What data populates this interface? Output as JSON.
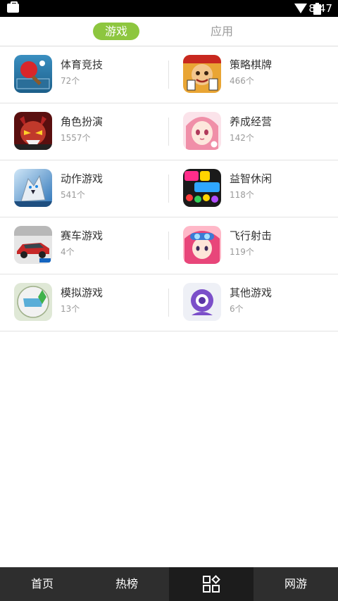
{
  "status_bar": {
    "time": "8:47",
    "icons": [
      "briefcase-icon",
      "wifi-icon",
      "battery-icon"
    ]
  },
  "tabs": [
    {
      "label": "游戏",
      "active": true
    },
    {
      "label": "应用",
      "active": false
    }
  ],
  "categories": [
    {
      "name": "体育竞技",
      "count": "72个",
      "icon": "table-tennis-icon"
    },
    {
      "name": "策略棋牌",
      "count": "466个",
      "icon": "card-game-icon"
    },
    {
      "name": "角色扮演",
      "count": "1557个",
      "icon": "monster-icon"
    },
    {
      "name": "养成经营",
      "count": "142个",
      "icon": "anime-girl-icon"
    },
    {
      "name": "动作游戏",
      "count": "541个",
      "icon": "wolf-icon"
    },
    {
      "name": "益智休闲",
      "count": "118个",
      "icon": "pop-candy-icon"
    },
    {
      "name": "赛车游戏",
      "count": "4个",
      "icon": "race-car-icon"
    },
    {
      "name": "飞行射击",
      "count": "119个",
      "icon": "pilot-girl-icon"
    },
    {
      "name": "模拟游戏",
      "count": "13个",
      "icon": "sims-icon"
    },
    {
      "name": "其他游戏",
      "count": "6个",
      "icon": "webcam-icon"
    }
  ],
  "bottom_nav": [
    {
      "label": "首页",
      "active": false
    },
    {
      "label": "热榜",
      "active": false
    },
    {
      "label": "",
      "icon": "grid-icon",
      "active": true
    },
    {
      "label": "网游",
      "active": false
    }
  ],
  "colors": {
    "accent": "#8dc63f",
    "nav_bg": "#2e2e2e",
    "nav_active": "#1c1c1c"
  }
}
